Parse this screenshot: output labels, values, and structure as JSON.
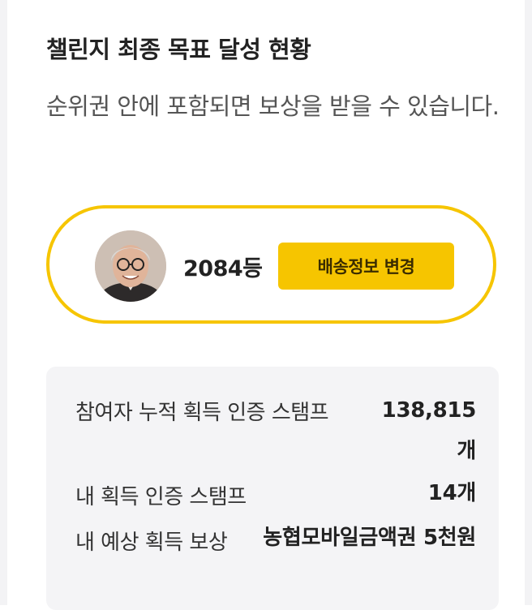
{
  "header": {
    "title": "챌린지 최종 목표 달성 현황",
    "subtitle": "순위권 안에 포함되면 보상을 받을 수 있습니다."
  },
  "rank_card": {
    "rank": "2084등",
    "change_delivery_button": "배송정보 변경",
    "border_color": "#f6c500"
  },
  "stats": [
    {
      "label": "참여자 누적 획득 인증 스탬프",
      "value": "138,815개"
    },
    {
      "label": "내 획득 인증 스탬프",
      "value": "14개"
    },
    {
      "label": "내 예상 획득 보상",
      "value": "농협모바일금액권 5천원"
    }
  ],
  "colors": {
    "accent": "#f6c500",
    "stats_background": "#f4f4f6"
  }
}
